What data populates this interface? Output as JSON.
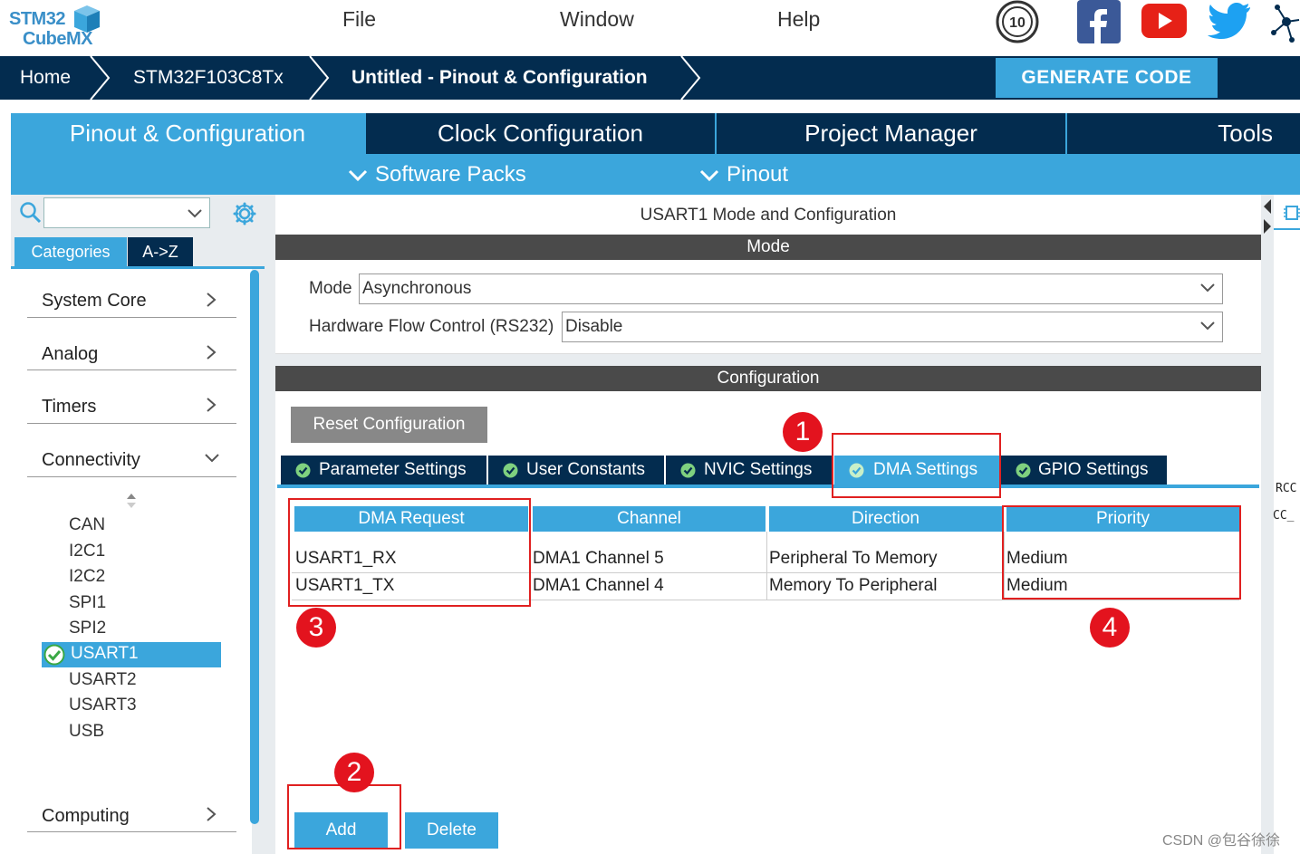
{
  "app": {
    "logo_line1": "STM32",
    "logo_line2": "CubeMX"
  },
  "menu": {
    "file": "File",
    "window": "Window",
    "help": "Help"
  },
  "social": {
    "icons": [
      "anniversary-10-icon",
      "facebook-icon",
      "youtube-icon",
      "twitter-icon",
      "network-icon"
    ],
    "anniversary_text": "10",
    "brand_colors": {
      "facebook": "#3b5998",
      "youtube": "#e62117",
      "twitter": "#1da1f2"
    }
  },
  "breadcrumb": {
    "home": "Home",
    "device": "STM32F103C8Tx",
    "project": "Untitled - Pinout & Configuration",
    "generate": "GENERATE CODE"
  },
  "tabs": {
    "pinout": "Pinout & Configuration",
    "clock": "Clock Configuration",
    "project": "Project Manager",
    "tools": "Tools",
    "software_packs": "Software Packs",
    "pinout_menu": "Pinout"
  },
  "left": {
    "search_value": "",
    "seg_categories": "Categories",
    "seg_az": "A->Z",
    "categories": [
      "System Core",
      "Analog",
      "Timers",
      "Connectivity",
      "Computing"
    ],
    "connectivity_items": [
      "CAN",
      "I2C1",
      "I2C2",
      "SPI1",
      "SPI2",
      "USART1",
      "USART2",
      "USART3",
      "USB"
    ],
    "selected": "USART1"
  },
  "center": {
    "title": "USART1 Mode and Configuration",
    "mode_header": "Mode",
    "mode_label": "Mode",
    "mode_value": "Asynchronous",
    "hwflow_label": "Hardware Flow Control (RS232)",
    "hwflow_value": "Disable",
    "config_header": "Configuration",
    "reset_btn": "Reset Configuration",
    "config_tabs": [
      "Parameter Settings",
      "User Constants",
      "NVIC Settings",
      "DMA Settings",
      "GPIO Settings"
    ],
    "active_tab": "DMA Settings",
    "table": {
      "headers": [
        "DMA Request",
        "Channel",
        "Direction",
        "Priority"
      ],
      "rows": [
        [
          "USART1_RX",
          "DMA1 Channel 5",
          "Peripheral To Memory",
          "Medium"
        ],
        [
          "USART1_TX",
          "DMA1 Channel 4",
          "Memory To Peripheral",
          "Medium"
        ]
      ]
    },
    "add_btn": "Add",
    "delete_btn": "Delete"
  },
  "annotations": [
    "1",
    "2",
    "3",
    "4"
  ],
  "right": {
    "label1": "RCC",
    "label2": "CC_"
  },
  "watermark": "CSDN @包谷徐徐",
  "colors": {
    "accent": "#3ba6dc",
    "navy": "#032c4f",
    "annotation_red": "#e02020"
  }
}
